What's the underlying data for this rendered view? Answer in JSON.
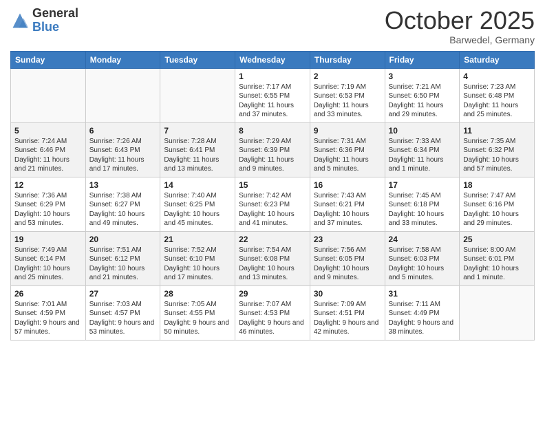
{
  "header": {
    "logo_general": "General",
    "logo_blue": "Blue",
    "month_title": "October 2025",
    "location": "Barwedel, Germany"
  },
  "days_of_week": [
    "Sunday",
    "Monday",
    "Tuesday",
    "Wednesday",
    "Thursday",
    "Friday",
    "Saturday"
  ],
  "weeks": [
    {
      "alt": false,
      "days": [
        {
          "number": "",
          "info": ""
        },
        {
          "number": "",
          "info": ""
        },
        {
          "number": "",
          "info": ""
        },
        {
          "number": "1",
          "info": "Sunrise: 7:17 AM\nSunset: 6:55 PM\nDaylight: 11 hours and 37 minutes."
        },
        {
          "number": "2",
          "info": "Sunrise: 7:19 AM\nSunset: 6:53 PM\nDaylight: 11 hours and 33 minutes."
        },
        {
          "number": "3",
          "info": "Sunrise: 7:21 AM\nSunset: 6:50 PM\nDaylight: 11 hours and 29 minutes."
        },
        {
          "number": "4",
          "info": "Sunrise: 7:23 AM\nSunset: 6:48 PM\nDaylight: 11 hours and 25 minutes."
        }
      ]
    },
    {
      "alt": true,
      "days": [
        {
          "number": "5",
          "info": "Sunrise: 7:24 AM\nSunset: 6:46 PM\nDaylight: 11 hours and 21 minutes."
        },
        {
          "number": "6",
          "info": "Sunrise: 7:26 AM\nSunset: 6:43 PM\nDaylight: 11 hours and 17 minutes."
        },
        {
          "number": "7",
          "info": "Sunrise: 7:28 AM\nSunset: 6:41 PM\nDaylight: 11 hours and 13 minutes."
        },
        {
          "number": "8",
          "info": "Sunrise: 7:29 AM\nSunset: 6:39 PM\nDaylight: 11 hours and 9 minutes."
        },
        {
          "number": "9",
          "info": "Sunrise: 7:31 AM\nSunset: 6:36 PM\nDaylight: 11 hours and 5 minutes."
        },
        {
          "number": "10",
          "info": "Sunrise: 7:33 AM\nSunset: 6:34 PM\nDaylight: 11 hours and 1 minute."
        },
        {
          "number": "11",
          "info": "Sunrise: 7:35 AM\nSunset: 6:32 PM\nDaylight: 10 hours and 57 minutes."
        }
      ]
    },
    {
      "alt": false,
      "days": [
        {
          "number": "12",
          "info": "Sunrise: 7:36 AM\nSunset: 6:29 PM\nDaylight: 10 hours and 53 minutes."
        },
        {
          "number": "13",
          "info": "Sunrise: 7:38 AM\nSunset: 6:27 PM\nDaylight: 10 hours and 49 minutes."
        },
        {
          "number": "14",
          "info": "Sunrise: 7:40 AM\nSunset: 6:25 PM\nDaylight: 10 hours and 45 minutes."
        },
        {
          "number": "15",
          "info": "Sunrise: 7:42 AM\nSunset: 6:23 PM\nDaylight: 10 hours and 41 minutes."
        },
        {
          "number": "16",
          "info": "Sunrise: 7:43 AM\nSunset: 6:21 PM\nDaylight: 10 hours and 37 minutes."
        },
        {
          "number": "17",
          "info": "Sunrise: 7:45 AM\nSunset: 6:18 PM\nDaylight: 10 hours and 33 minutes."
        },
        {
          "number": "18",
          "info": "Sunrise: 7:47 AM\nSunset: 6:16 PM\nDaylight: 10 hours and 29 minutes."
        }
      ]
    },
    {
      "alt": true,
      "days": [
        {
          "number": "19",
          "info": "Sunrise: 7:49 AM\nSunset: 6:14 PM\nDaylight: 10 hours and 25 minutes."
        },
        {
          "number": "20",
          "info": "Sunrise: 7:51 AM\nSunset: 6:12 PM\nDaylight: 10 hours and 21 minutes."
        },
        {
          "number": "21",
          "info": "Sunrise: 7:52 AM\nSunset: 6:10 PM\nDaylight: 10 hours and 17 minutes."
        },
        {
          "number": "22",
          "info": "Sunrise: 7:54 AM\nSunset: 6:08 PM\nDaylight: 10 hours and 13 minutes."
        },
        {
          "number": "23",
          "info": "Sunrise: 7:56 AM\nSunset: 6:05 PM\nDaylight: 10 hours and 9 minutes."
        },
        {
          "number": "24",
          "info": "Sunrise: 7:58 AM\nSunset: 6:03 PM\nDaylight: 10 hours and 5 minutes."
        },
        {
          "number": "25",
          "info": "Sunrise: 8:00 AM\nSunset: 6:01 PM\nDaylight: 10 hours and 1 minute."
        }
      ]
    },
    {
      "alt": false,
      "days": [
        {
          "number": "26",
          "info": "Sunrise: 7:01 AM\nSunset: 4:59 PM\nDaylight: 9 hours and 57 minutes."
        },
        {
          "number": "27",
          "info": "Sunrise: 7:03 AM\nSunset: 4:57 PM\nDaylight: 9 hours and 53 minutes."
        },
        {
          "number": "28",
          "info": "Sunrise: 7:05 AM\nSunset: 4:55 PM\nDaylight: 9 hours and 50 minutes."
        },
        {
          "number": "29",
          "info": "Sunrise: 7:07 AM\nSunset: 4:53 PM\nDaylight: 9 hours and 46 minutes."
        },
        {
          "number": "30",
          "info": "Sunrise: 7:09 AM\nSunset: 4:51 PM\nDaylight: 9 hours and 42 minutes."
        },
        {
          "number": "31",
          "info": "Sunrise: 7:11 AM\nSunset: 4:49 PM\nDaylight: 9 hours and 38 minutes."
        },
        {
          "number": "",
          "info": ""
        }
      ]
    }
  ]
}
